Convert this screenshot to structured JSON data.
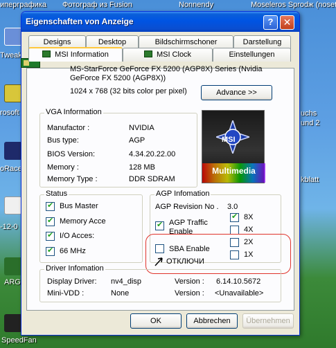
{
  "desktop": {
    "top_strip": [
      "иперграфика",
      "Фотограф из Fusion",
      "Nonnendy",
      "Mоsеlеrоs Sрrоdж (nosetup)"
    ],
    "left_labels": [
      "Tweak",
      "rosoft",
      "oRace",
      "-12-0",
      "ARG",
      "SpeedFan"
    ],
    "right_labels": [
      "uchs",
      "und 2",
      "kblatt"
    ]
  },
  "window": {
    "title": "Eigenschaften von Anzeige",
    "help_btn": "?",
    "close_btn": "✕"
  },
  "tabs": {
    "row1": [
      "Designs",
      "Desktop",
      "Bildschirmschoner",
      "Darstellung"
    ],
    "row2": [
      "MSI Information",
      "MSI Clock",
      "Einstellungen"
    ]
  },
  "card": {
    "name": "MS-StarForce GeForce FX 5200 (AGP8X) Series (Nvidia GeForce FX 5200 (AGP8X))",
    "resolution": "1024 x 768 (32 bits color per pixel)",
    "advance_btn": "Advance >>"
  },
  "vga": {
    "title": "VGA Information",
    "rows": [
      {
        "label": "Manufactor :",
        "value": "NVIDIA"
      },
      {
        "label": "Bus type:",
        "value": "AGP"
      },
      {
        "label": "BIOS Version:",
        "value": "4.34.20.22.00"
      },
      {
        "label": "Memory :",
        "value": "128 MB"
      },
      {
        "label": "Memory Type :",
        "value": "DDR SDRAM"
      }
    ]
  },
  "logo": {
    "brand": "MSI",
    "caption": "Multimedia"
  },
  "status": {
    "title": "Status",
    "items": [
      {
        "label": "Bus Master",
        "checked": true
      },
      {
        "label": "Memory Acce",
        "checked": true
      },
      {
        "label": "I/O Acces:",
        "checked": true
      },
      {
        "label": "66 MHz",
        "checked": true
      }
    ]
  },
  "agp": {
    "title": "AGP Infomation",
    "revision_label": "AGP Revision No .",
    "revision_value": "3.0",
    "traffic": {
      "label": "AGP Traffic Enable",
      "checked": true
    },
    "sba": {
      "label": "SBA Enable",
      "checked": false
    },
    "annotation": "ОТКЛЮЧИ",
    "rates": [
      {
        "label": "8X",
        "checked": true
      },
      {
        "label": "4X",
        "checked": false
      },
      {
        "label": "2X",
        "checked": false
      },
      {
        "label": "1X",
        "checked": false
      }
    ]
  },
  "driver": {
    "title": "Driver Infomation",
    "display_label": "Display Driver:",
    "display_value": "nv4_disp",
    "version_label": "Version :",
    "display_version": "6.14.10.5672",
    "minivdd_label": "Mini-VDD :",
    "minivdd_value": "None",
    "minivdd_version": "<Unavailable>"
  },
  "buttons": {
    "ok": "OK",
    "cancel": "Abbrechen",
    "apply": "Übernehmen"
  }
}
